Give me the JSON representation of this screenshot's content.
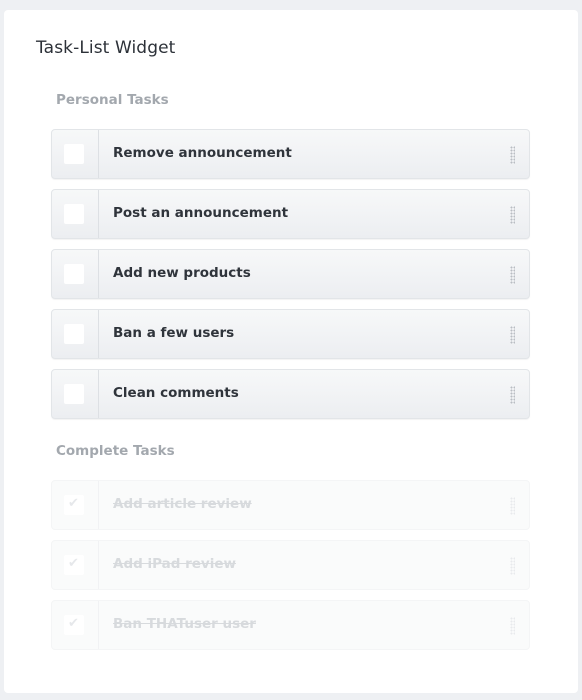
{
  "widget": {
    "title": "Task-List Widget"
  },
  "personal": {
    "title": "Personal Tasks",
    "tasks": [
      {
        "label": "Remove announcement",
        "done": false
      },
      {
        "label": "Post an announcement",
        "done": false
      },
      {
        "label": "Add new products",
        "done": false
      },
      {
        "label": "Ban a few users",
        "done": false
      },
      {
        "label": "Clean comments",
        "done": false
      }
    ]
  },
  "complete": {
    "title": "Complete Tasks",
    "tasks": [
      {
        "label": "Add article review",
        "done": true
      },
      {
        "label": "Add iPad review",
        "done": true
      },
      {
        "label": "Ban THATuser user",
        "done": true
      }
    ]
  },
  "icons": {
    "checkmark": "checkmark-icon",
    "drag": "drag-handle-icon"
  },
  "colors": {
    "text": "#2f343b",
    "section": "#a3a8ae",
    "done_text": "#d7dadd"
  }
}
